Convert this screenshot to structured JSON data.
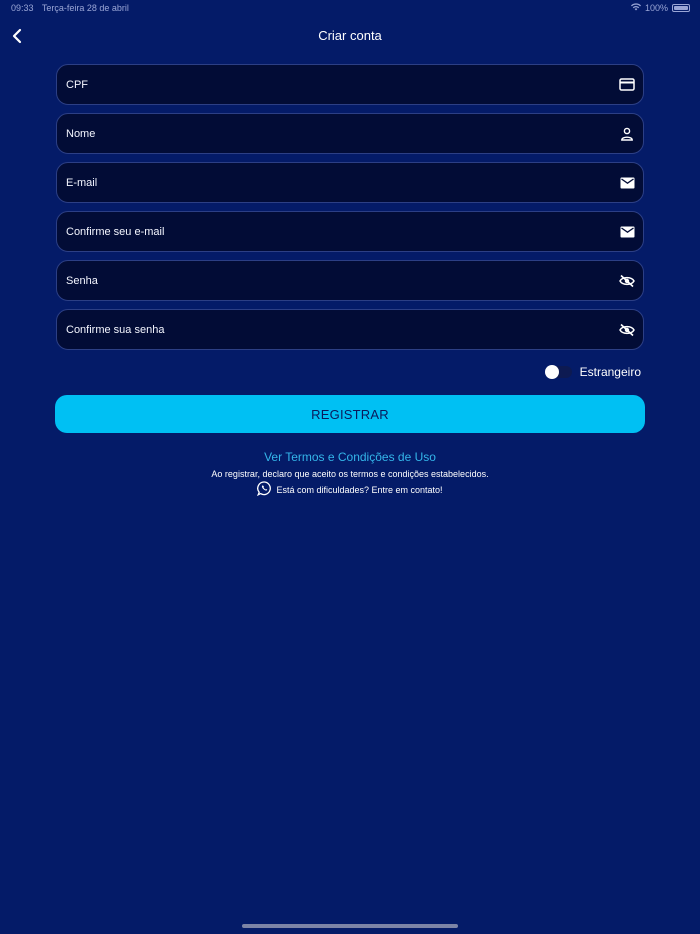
{
  "status_bar": {
    "time": "09:33",
    "date": "Terça-feira 28 de abril",
    "battery": "100%",
    "icons": [
      "wifi-icon",
      "battery-icon"
    ]
  },
  "nav": {
    "title": "Criar conta",
    "back_icon": "chevron-left-icon"
  },
  "form": {
    "fields": [
      {
        "label": "CPF",
        "icon": "card-icon"
      },
      {
        "label": "Nome",
        "icon": "person-icon"
      },
      {
        "label": "E-mail",
        "icon": "mail-icon"
      },
      {
        "label": "Confirme seu e-mail",
        "icon": "mail-icon"
      },
      {
        "label": "Senha",
        "icon": "eye-off-icon"
      },
      {
        "label": "Confirme sua senha",
        "icon": "eye-off-icon"
      }
    ],
    "foreigner_toggle": {
      "label": "Estrangeiro",
      "on": false
    },
    "register_label": "REGISTRAR"
  },
  "footer": {
    "terms_link": "Ver Termos e Condições de Uso",
    "disclaimer": "Ao registrar, declaro que aceito os termos e condições estabelecidos.",
    "contact": "Está com dificuldades? Entre em contato!",
    "contact_icon": "whatsapp-icon"
  },
  "colors": {
    "background": "#041b68",
    "field_bg": "#020c36",
    "accent": "#00c0f3",
    "link": "#34b6ea"
  }
}
